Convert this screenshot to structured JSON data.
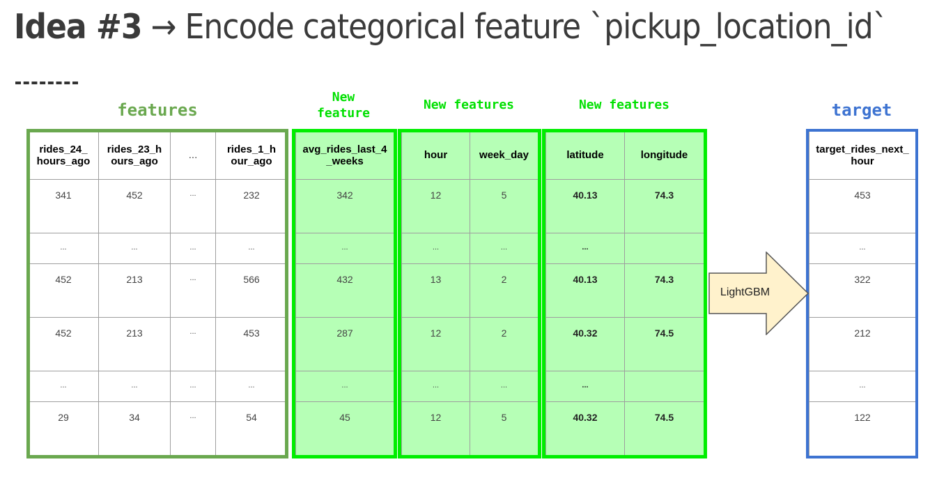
{
  "title": {
    "prefix": "Idea #3",
    "rest": " → Encode categorical feature `pickup_location_id`"
  },
  "labels": {
    "features": "features",
    "new_feature": [
      "New",
      "feature"
    ],
    "new_features_a": "New features",
    "new_features_b": "New features",
    "target": "target"
  },
  "arrow_label": "LightGBM",
  "features_table": {
    "headers": [
      "rides_24_\nhours_ago",
      "rides_23_h\nours_ago",
      "...",
      "rides_1_h\nour_ago"
    ],
    "rows": [
      [
        "341",
        "452",
        "...",
        "232"
      ],
      [
        "...",
        "...",
        "...",
        "..."
      ],
      [
        "452",
        "213",
        "...",
        "566"
      ],
      [
        "452",
        "213",
        "...",
        "453"
      ],
      [
        "...",
        "...",
        "...",
        "..."
      ],
      [
        "29",
        "34",
        "...",
        "54"
      ]
    ]
  },
  "new_feature_table": {
    "headers": [
      "avg_rides_last_4\n_weeks"
    ],
    "rows": [
      [
        "342"
      ],
      [
        "..."
      ],
      [
        "432"
      ],
      [
        "287"
      ],
      [
        "..."
      ],
      [
        "45"
      ]
    ]
  },
  "time_table": {
    "headers": [
      "hour",
      "week_day"
    ],
    "rows": [
      [
        "12",
        "5"
      ],
      [
        "...",
        "..."
      ],
      [
        "13",
        "2"
      ],
      [
        "12",
        "2"
      ],
      [
        "...",
        "..."
      ],
      [
        "12",
        "5"
      ]
    ]
  },
  "geo_table": {
    "headers": [
      "latitude",
      "longitude"
    ],
    "rows": [
      [
        "40.13",
        "74.3"
      ],
      [
        "...",
        ""
      ],
      [
        "40.13",
        "74.3"
      ],
      [
        "40.32",
        "74.5"
      ],
      [
        "...",
        ""
      ],
      [
        "40.32",
        "74.5"
      ]
    ]
  },
  "target_table": {
    "headers": [
      "target_rides_next_\nhour"
    ],
    "rows": [
      [
        "453"
      ],
      [
        "..."
      ],
      [
        "322"
      ],
      [
        "212"
      ],
      [
        "..."
      ],
      [
        "122"
      ]
    ]
  },
  "colors": {
    "features": "#6aa84f",
    "new_features": "#00ee00",
    "target": "#3d73d1",
    "arrow_fill": "#fff2cc"
  }
}
